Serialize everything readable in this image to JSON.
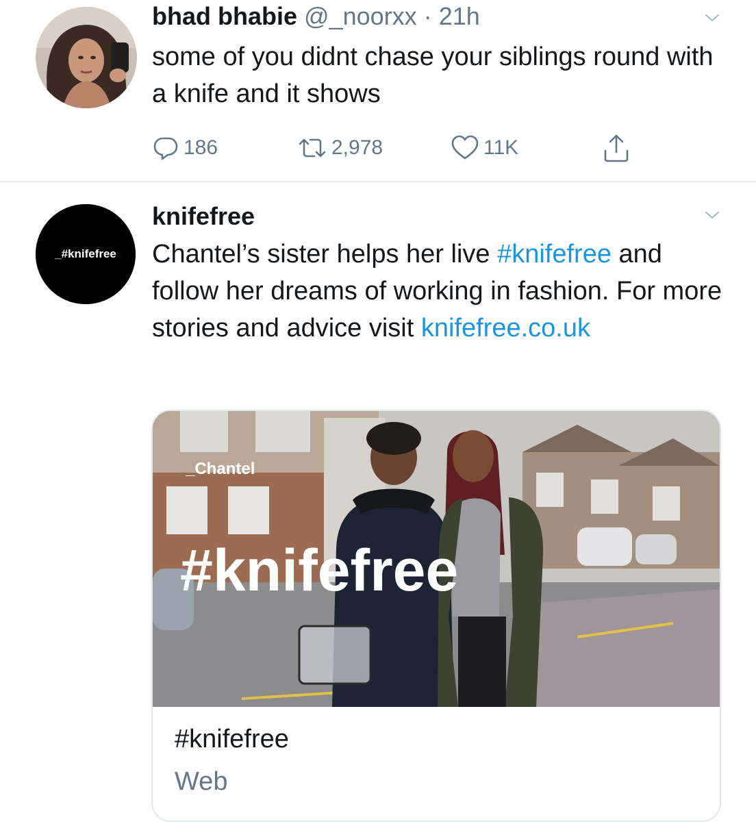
{
  "tweets": [
    {
      "name": "bhad bhabie",
      "handle": "@_noorxx",
      "dot": "·",
      "time": "21h",
      "text": "some of you didnt chase your siblings round with a knife and it shows",
      "actions": {
        "replies": "186",
        "retweets": "2,978",
        "likes": "11K"
      }
    },
    {
      "name": "knifefree",
      "avatar_text": "_#knifefree",
      "text_parts": [
        "Chantel’s sister helps her live ",
        "#knifefree",
        " and follow her dreams of working in fashion. For more stories and advice visit ",
        "knifefree.co.uk"
      ],
      "card": {
        "image_name_tag": "_Chantel",
        "image_hashtag": "#knifefree",
        "title": "#knifefree",
        "domain": "Web"
      }
    }
  ],
  "colors": {
    "link": "#1b95e0",
    "secondary": "#657786",
    "divider": "#e6ecf0"
  },
  "icons": [
    "chevron-down-icon",
    "reply-icon",
    "retweet-icon",
    "like-icon",
    "share-icon"
  ]
}
